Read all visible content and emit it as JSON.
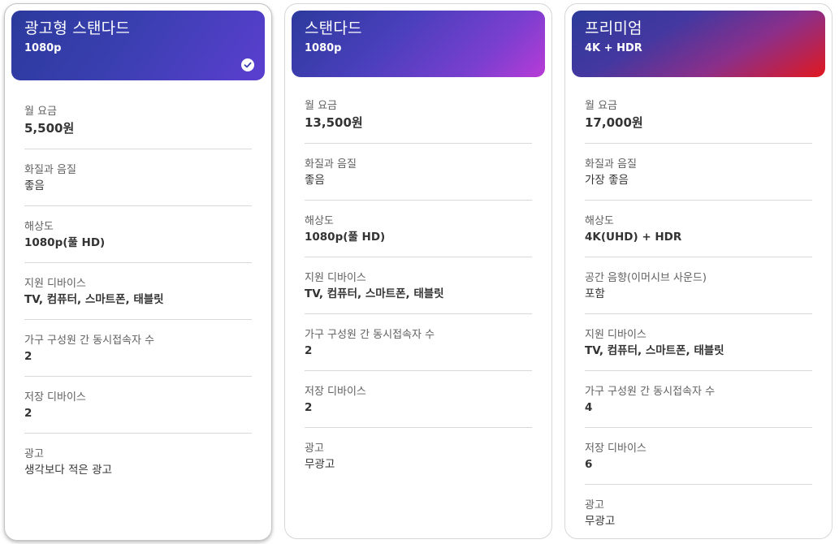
{
  "plans": [
    {
      "name": "광고형 스탠다드",
      "resolution_badge": "1080p",
      "selected": true,
      "features": [
        {
          "label": "월 요금",
          "value": "5,500원"
        },
        {
          "label": "화질과 음질",
          "value": "좋음"
        },
        {
          "label": "해상도",
          "value": "1080p(풀 HD)"
        },
        {
          "label": "지원 디바이스",
          "value": "TV, 컴퓨터, 스마트폰, 태블릿"
        },
        {
          "label": "가구 구성원 간 동시접속자 수",
          "value": "2"
        },
        {
          "label": "저장 디바이스",
          "value": "2"
        },
        {
          "label": "광고",
          "value": "생각보다 적은 광고"
        }
      ]
    },
    {
      "name": "스탠다드",
      "resolution_badge": "1080p",
      "selected": false,
      "features": [
        {
          "label": "월 요금",
          "value": "13,500원"
        },
        {
          "label": "화질과 음질",
          "value": "좋음"
        },
        {
          "label": "해상도",
          "value": "1080p(풀 HD)"
        },
        {
          "label": "지원 디바이스",
          "value": "TV, 컴퓨터, 스마트폰, 태블릿"
        },
        {
          "label": "가구 구성원 간 동시접속자 수",
          "value": "2"
        },
        {
          "label": "저장 디바이스",
          "value": "2"
        },
        {
          "label": "광고",
          "value": "무광고"
        }
      ]
    },
    {
      "name": "프리미엄",
      "resolution_badge": "4K + HDR",
      "selected": false,
      "features": [
        {
          "label": "월 요금",
          "value": "17,000원"
        },
        {
          "label": "화질과 음질",
          "value": "가장 좋음"
        },
        {
          "label": "해상도",
          "value": "4K(UHD) + HDR"
        },
        {
          "label": "공간 음향(이머시브 사운드)",
          "value": "포함"
        },
        {
          "label": "지원 디바이스",
          "value": "TV, 컴퓨터, 스마트폰, 태블릿"
        },
        {
          "label": "가구 구성원 간 동시접속자 수",
          "value": "4"
        },
        {
          "label": "저장 디바이스",
          "value": "6"
        },
        {
          "label": "광고",
          "value": "무광고"
        }
      ]
    }
  ],
  "icons": {
    "selected_check": "check-circle-icon"
  },
  "colors": {
    "basic_header": "#3a3fb0",
    "standard_header_end": "#b83bd6",
    "premium_header_end": "#e0181f"
  }
}
